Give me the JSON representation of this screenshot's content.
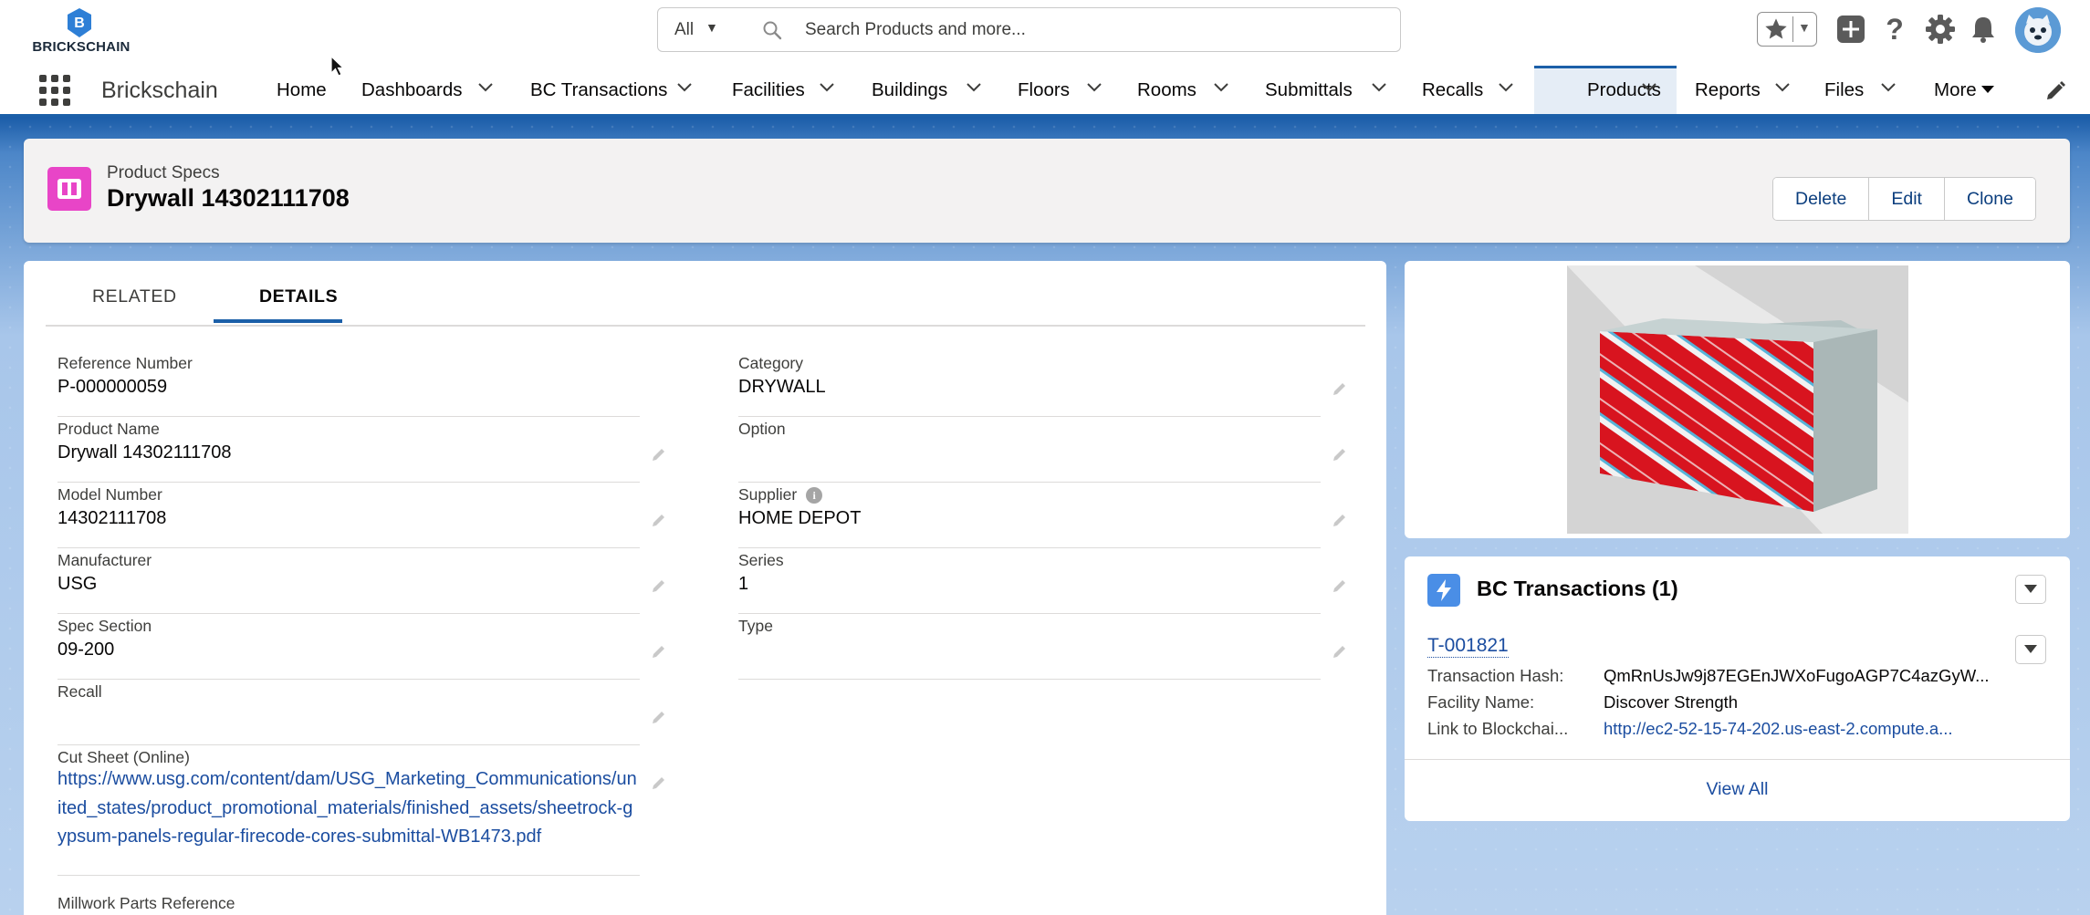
{
  "header": {
    "logo_text": "BRICKSCHAIN",
    "logo_letter": "B",
    "search_scope": "All",
    "search_placeholder": "Search Products and more..."
  },
  "nav": {
    "app_name": "Brickschain",
    "items": [
      {
        "label": "Home",
        "has_menu": false
      },
      {
        "label": "Dashboards",
        "has_menu": true
      },
      {
        "label": "BC Transactions",
        "has_menu": true
      },
      {
        "label": "Facilities",
        "has_menu": true
      },
      {
        "label": "Buildings",
        "has_menu": true
      },
      {
        "label": "Floors",
        "has_menu": true
      },
      {
        "label": "Rooms",
        "has_menu": true
      },
      {
        "label": "Submittals",
        "has_menu": true
      },
      {
        "label": "Recalls",
        "has_menu": true
      },
      {
        "label": "Products",
        "has_menu": true,
        "active": true
      },
      {
        "label": "Reports",
        "has_menu": true
      },
      {
        "label": "Files",
        "has_menu": true
      },
      {
        "label": "More",
        "has_menu": true
      }
    ]
  },
  "record": {
    "object_type": "Product Specs",
    "title": "Drywall 14302111708",
    "actions": [
      "Delete",
      "Edit",
      "Clone"
    ]
  },
  "tabs": [
    "RELATED",
    "DETAILS"
  ],
  "active_tab": "DETAILS",
  "fields": {
    "reference_number": {
      "label": "Reference Number",
      "value": "P-000000059"
    },
    "product_name": {
      "label": "Product Name",
      "value": "Drywall 14302111708"
    },
    "model_number": {
      "label": "Model Number",
      "value": "14302111708"
    },
    "manufacturer": {
      "label": "Manufacturer",
      "value": "USG"
    },
    "spec_section": {
      "label": "Spec Section",
      "value": "09-200"
    },
    "recall": {
      "label": "Recall",
      "value": ""
    },
    "cut_sheet": {
      "label": "Cut Sheet (Online)",
      "value": "https://www.usg.com/content/dam/USG_Marketing_Communications/united_states/product_promotional_materials/finished_assets/sheetrock-gypsum-panels-regular-firecode-cores-submittal-WB1473.pdf"
    },
    "millwork": {
      "label": "Millwork Parts Reference"
    },
    "category": {
      "label": "Category",
      "value": "DRYWALL"
    },
    "option": {
      "label": "Option",
      "value": ""
    },
    "supplier": {
      "label": "Supplier",
      "value": "HOME DEPOT",
      "info_glyph": "i"
    },
    "series": {
      "label": "Series",
      "value": "1"
    },
    "type": {
      "label": "Type",
      "value": ""
    }
  },
  "bc_transactions": {
    "title": "BC Transactions (1)",
    "record_id": "T-001821",
    "rows": [
      {
        "key": "Transaction Hash:",
        "value": "QmRnUsJw9j87EGEnJWXoFugoAGP7C4azGyW..."
      },
      {
        "key": "Facility Name:",
        "value": "Discover Strength"
      },
      {
        "key": "Link to Blockchai...",
        "value": "http://ec2-52-15-74-202.us-east-2.compute.a..."
      }
    ],
    "view_all": "View All"
  },
  "colors": {
    "brand_blue": "#1b5fa8",
    "product_icon": "#e845c7",
    "transaction_icon": "#4a8ee6",
    "link": "#1b4da0"
  }
}
